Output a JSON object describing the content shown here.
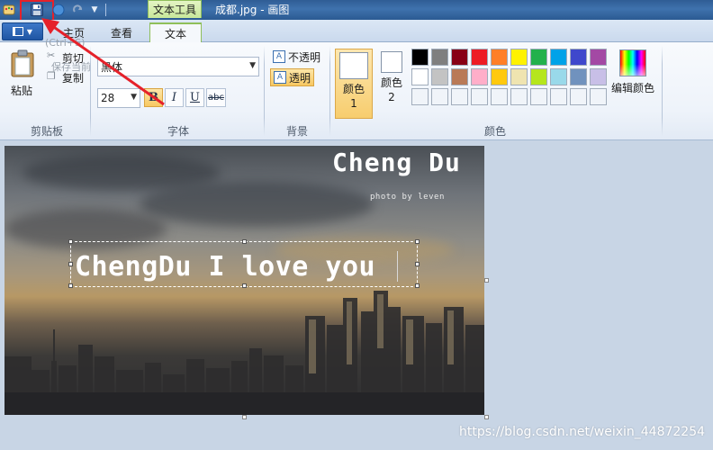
{
  "window": {
    "title": "成都.jpg - 画图",
    "context_tab_group": "文本工具"
  },
  "quick_access": {
    "items": [
      "app-icon",
      "save-icon",
      "undo-icon",
      "redo-icon",
      "customize-icon"
    ]
  },
  "tabs": [
    {
      "label": "主页",
      "selected": false
    },
    {
      "label": "查看",
      "selected": false
    },
    {
      "label": "文本",
      "selected": true
    }
  ],
  "tooltip_overlay": {
    "shortcut": "(Ctrl+S)",
    "line2": "保存当前"
  },
  "clipboard": {
    "group_label": "剪贴板",
    "paste": "粘贴",
    "cut": "剪切",
    "copy": "复制"
  },
  "font": {
    "group_label": "字体",
    "family": "黑体",
    "size": "28",
    "bold": "B",
    "italic": "I",
    "underline": "U",
    "strikethrough": "abc",
    "bold_active": true
  },
  "background": {
    "group_label": "背景",
    "opaque": "不透明",
    "transparent": "透明",
    "transparent_active": true
  },
  "colors": {
    "group_label": "颜色",
    "color1_label": "颜色 1",
    "color2_label": "颜色 2",
    "color1": "#ffffff",
    "color2": "#ffffff",
    "edit_colors": "编辑颜色",
    "palette_row1": [
      "#000000",
      "#7f7f7f",
      "#880015",
      "#ed1c24",
      "#ff7f27",
      "#fff200",
      "#22b14c",
      "#00a2e8",
      "#3f48cc",
      "#a349a4"
    ],
    "palette_row2": [
      "#ffffff",
      "#c3c3c3",
      "#b97a57",
      "#ffaec9",
      "#ffc90e",
      "#efe4b0",
      "#b5e61d",
      "#99d9ea",
      "#7092be",
      "#c8bfe7"
    ],
    "palette_row3": [
      "#f0f4f9",
      "#f0f4f9",
      "#f0f4f9",
      "#f0f4f9",
      "#f0f4f9",
      "#f0f4f9",
      "#f0f4f9",
      "#f0f4f9",
      "#f0f4f9",
      "#f0f4f9"
    ]
  },
  "image": {
    "title": "Cheng Du",
    "credit": "photo by leven",
    "text_box_content": "ChengDu I love you"
  },
  "watermark": "https://blog.csdn.net/weixin_44872254",
  "accent": {
    "highlight_red": "#e5212a",
    "active_yellow": "#f7c862",
    "context_green": "#8fbf5a"
  }
}
